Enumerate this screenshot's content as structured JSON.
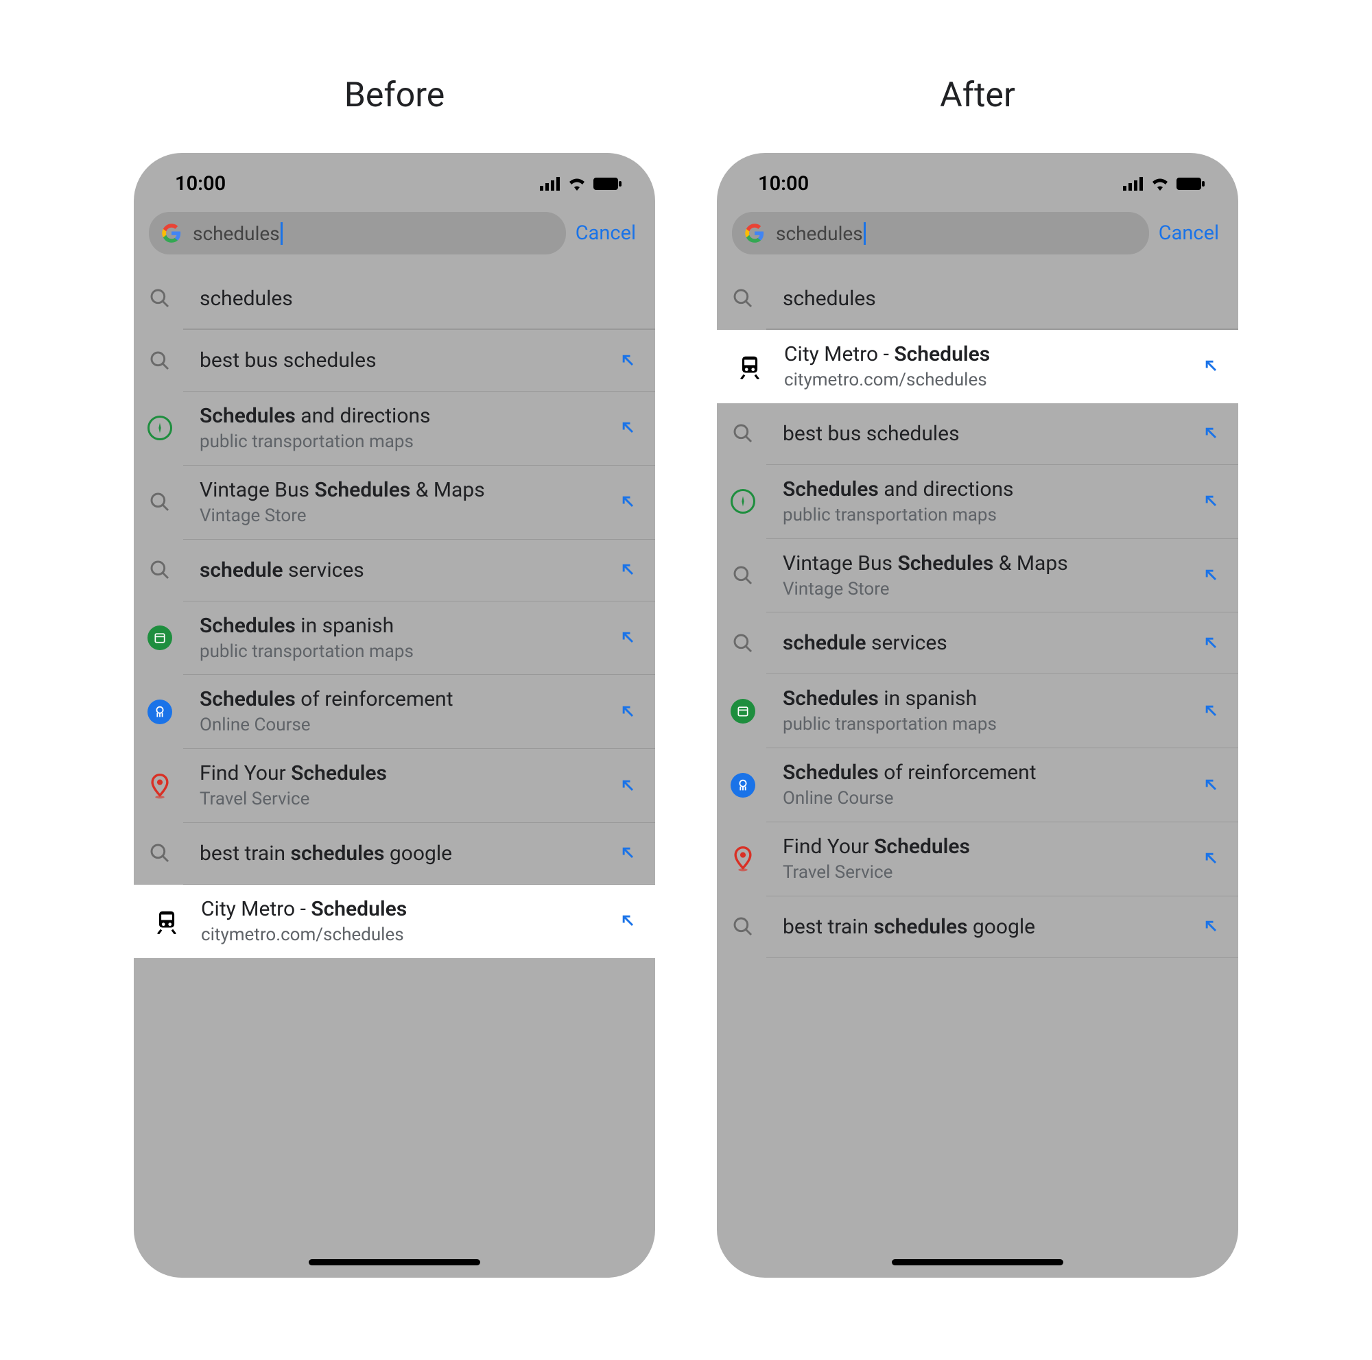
{
  "headings": {
    "before": "Before",
    "after": "After"
  },
  "status": {
    "time": "10:00"
  },
  "search": {
    "query": "schedules",
    "cancel": "Cancel"
  },
  "suggestions_before": [
    {
      "icon": "search",
      "title_parts": [
        {
          "t": "schedules",
          "b": false
        }
      ],
      "sub": "",
      "arrow": false,
      "highlight": false
    },
    {
      "icon": "search",
      "title_parts": [
        {
          "t": "best bus schedules",
          "b": false
        }
      ],
      "sub": "",
      "arrow": true,
      "highlight": false
    },
    {
      "icon": "compass",
      "title_parts": [
        {
          "t": "Schedules",
          "b": true
        },
        {
          "t": " and directions",
          "b": false
        }
      ],
      "sub": "public transportation maps",
      "arrow": true,
      "highlight": false
    },
    {
      "icon": "search",
      "title_parts": [
        {
          "t": "Vintage Bus ",
          "b": false
        },
        {
          "t": "Schedules",
          "b": true
        },
        {
          "t": " & Maps",
          "b": false
        }
      ],
      "sub": "Vintage Store",
      "arrow": true,
      "highlight": false
    },
    {
      "icon": "search",
      "title_parts": [
        {
          "t": "schedule",
          "b": true
        },
        {
          "t": " services",
          "b": false
        }
      ],
      "sub": "",
      "arrow": true,
      "highlight": false
    },
    {
      "icon": "calendar",
      "title_parts": [
        {
          "t": "Schedules",
          "b": true
        },
        {
          "t": " in spanish",
          "b": false
        }
      ],
      "sub": "public transportation maps",
      "arrow": true,
      "highlight": false
    },
    {
      "icon": "brain",
      "title_parts": [
        {
          "t": "Schedules",
          "b": true
        },
        {
          "t": " of reinforcement",
          "b": false
        }
      ],
      "sub": "Online Course",
      "arrow": true,
      "highlight": false
    },
    {
      "icon": "pin",
      "title_parts": [
        {
          "t": "Find Your ",
          "b": false
        },
        {
          "t": "Schedules",
          "b": true
        }
      ],
      "sub": "Travel Service",
      "arrow": true,
      "highlight": false
    },
    {
      "icon": "search",
      "title_parts": [
        {
          "t": "best train ",
          "b": false
        },
        {
          "t": "schedules",
          "b": true
        },
        {
          "t": " google",
          "b": false
        }
      ],
      "sub": "",
      "arrow": true,
      "highlight": false
    },
    {
      "icon": "train",
      "title_parts": [
        {
          "t": "City Metro -  ",
          "b": false
        },
        {
          "t": "Schedules",
          "b": true
        }
      ],
      "sub": "citymetro.com/schedules",
      "arrow": true,
      "highlight": true
    }
  ],
  "suggestions_after": [
    {
      "icon": "search",
      "title_parts": [
        {
          "t": "schedules",
          "b": false
        }
      ],
      "sub": "",
      "arrow": false,
      "highlight": false
    },
    {
      "icon": "train",
      "title_parts": [
        {
          "t": "City Metro -  ",
          "b": false
        },
        {
          "t": "Schedules",
          "b": true
        }
      ],
      "sub": "citymetro.com/schedules",
      "arrow": true,
      "highlight": true
    },
    {
      "icon": "search",
      "title_parts": [
        {
          "t": "best bus schedules",
          "b": false
        }
      ],
      "sub": "",
      "arrow": true,
      "highlight": false
    },
    {
      "icon": "compass",
      "title_parts": [
        {
          "t": "Schedules",
          "b": true
        },
        {
          "t": " and directions",
          "b": false
        }
      ],
      "sub": "public transportation maps",
      "arrow": true,
      "highlight": false
    },
    {
      "icon": "search",
      "title_parts": [
        {
          "t": "Vintage Bus ",
          "b": false
        },
        {
          "t": "Schedules",
          "b": true
        },
        {
          "t": " & Maps",
          "b": false
        }
      ],
      "sub": "Vintage Store",
      "arrow": true,
      "highlight": false
    },
    {
      "icon": "search",
      "title_parts": [
        {
          "t": "schedule",
          "b": true
        },
        {
          "t": " services",
          "b": false
        }
      ],
      "sub": "",
      "arrow": true,
      "highlight": false
    },
    {
      "icon": "calendar",
      "title_parts": [
        {
          "t": "Schedules",
          "b": true
        },
        {
          "t": " in spanish",
          "b": false
        }
      ],
      "sub": "public transportation maps",
      "arrow": true,
      "highlight": false
    },
    {
      "icon": "brain",
      "title_parts": [
        {
          "t": "Schedules",
          "b": true
        },
        {
          "t": " of reinforcement",
          "b": false
        }
      ],
      "sub": "Online Course",
      "arrow": true,
      "highlight": false
    },
    {
      "icon": "pin",
      "title_parts": [
        {
          "t": "Find Your ",
          "b": false
        },
        {
          "t": "Schedules",
          "b": true
        }
      ],
      "sub": "Travel Service",
      "arrow": true,
      "highlight": false
    },
    {
      "icon": "search",
      "title_parts": [
        {
          "t": "best train ",
          "b": false
        },
        {
          "t": "schedules",
          "b": true
        },
        {
          "t": " google",
          "b": false
        }
      ],
      "sub": "",
      "arrow": true,
      "highlight": false
    }
  ],
  "icon_names": {
    "search": "search-icon",
    "compass": "compass-icon",
    "calendar": "calendar-icon",
    "brain": "psychology-icon",
    "pin": "map-pin-icon",
    "train": "train-icon"
  },
  "colors": {
    "link_blue": "#1a73e8",
    "highlight_bg": "#ffffff",
    "dim_bg": "#aeaeae"
  }
}
